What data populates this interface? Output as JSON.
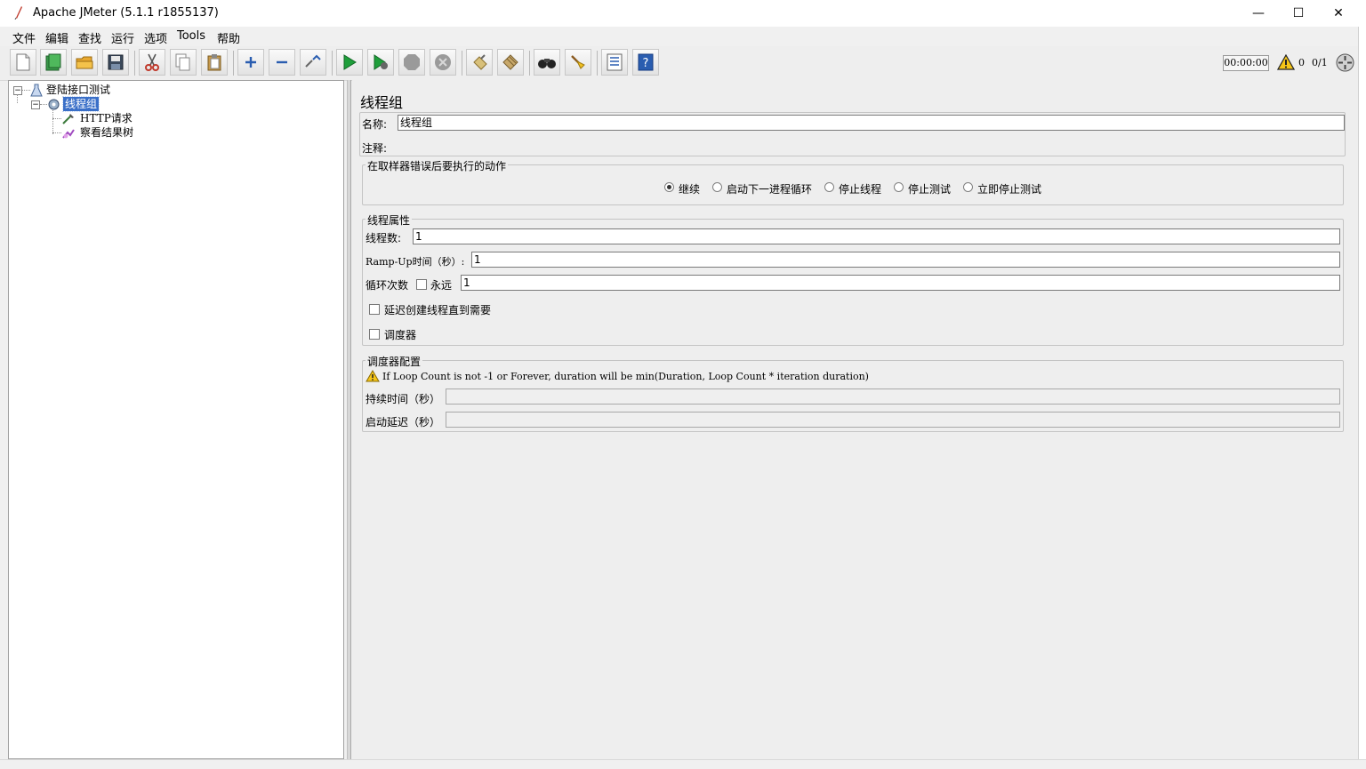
{
  "window": {
    "title": "Apache JMeter (5.1.1 r1855137)",
    "minimize": "—",
    "maximize": "☐",
    "close": "✕"
  },
  "menu": [
    "文件",
    "编辑",
    "查找",
    "运行",
    "选项",
    "Tools",
    "帮助"
  ],
  "toolbar": {
    "buttons": [
      "new-icon",
      "templates-icon",
      "open-icon",
      "save-icon",
      "cut-icon",
      "copy-icon",
      "paste-icon",
      "expand-icon",
      "collapse-icon",
      "toggle-icon",
      "start-icon",
      "start-no-pauses-icon",
      "stop-icon",
      "shutdown-icon",
      "clear-icon",
      "clear-all-icon",
      "search-icon",
      "reset-search-icon",
      "function-helper-icon",
      "help-icon"
    ],
    "timer": "00:00:00",
    "warnings": "0",
    "threads": "0/1"
  },
  "tree": {
    "root": "登陆接口测试",
    "thread_group": "线程组",
    "children": [
      "HTTP请求",
      "察看结果树"
    ]
  },
  "panel": {
    "title": "线程组",
    "name_label": "名称:",
    "name_value": "线程组",
    "comment_label": "注释:",
    "error_action": {
      "title": "在取样器错误后要执行的动作",
      "options": [
        "继续",
        "启动下一进程循环",
        "停止线程",
        "停止测试",
        "立即停止测试"
      ],
      "selected": "继续"
    },
    "thread_props": {
      "title": "线程属性",
      "threads_label": "线程数:",
      "threads_value": "1",
      "rampup_label": "Ramp-Up时间（秒）:",
      "rampup_value": "1",
      "loop_label": "循环次数",
      "forever_label": "永远",
      "loop_value": "1",
      "delay_label": "延迟创建线程直到需要",
      "scheduler_label": "调度器"
    },
    "scheduler": {
      "title": "调度器配置",
      "warning": "If Loop Count is not -1 or Forever, duration will be min(Duration, Loop Count * iteration duration)",
      "duration_label": "持续时间（秒）",
      "startup_label": "启动延迟（秒）"
    }
  }
}
